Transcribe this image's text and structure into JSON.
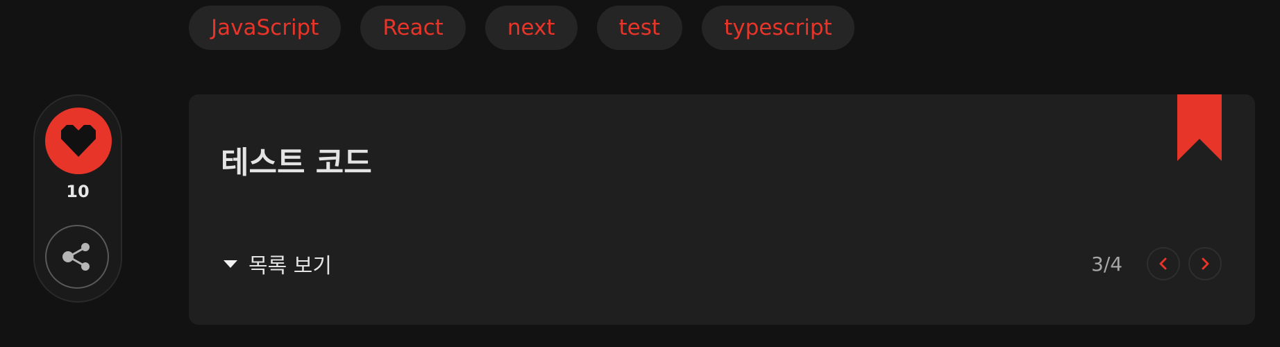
{
  "tags": [
    "JavaScript",
    "React",
    "next",
    "test",
    "typescript"
  ],
  "like": {
    "count": "10",
    "icon": "heart-icon"
  },
  "share": {
    "icon": "share-icon"
  },
  "card": {
    "title": "테스트 코드",
    "toc_label": "목록 보기",
    "toc_icon": "triangle-down-icon",
    "bookmark_icon": "bookmark-icon",
    "pager": "3/4",
    "prev_icon": "chevron-left-icon",
    "next_icon": "chevron-right-icon"
  },
  "colors": {
    "background": "#121212",
    "card": "#1f1f1f",
    "accent": "#e8352a",
    "tag_bg": "#252525",
    "text": "#e4e4e4",
    "muted": "#a6a6a6"
  }
}
